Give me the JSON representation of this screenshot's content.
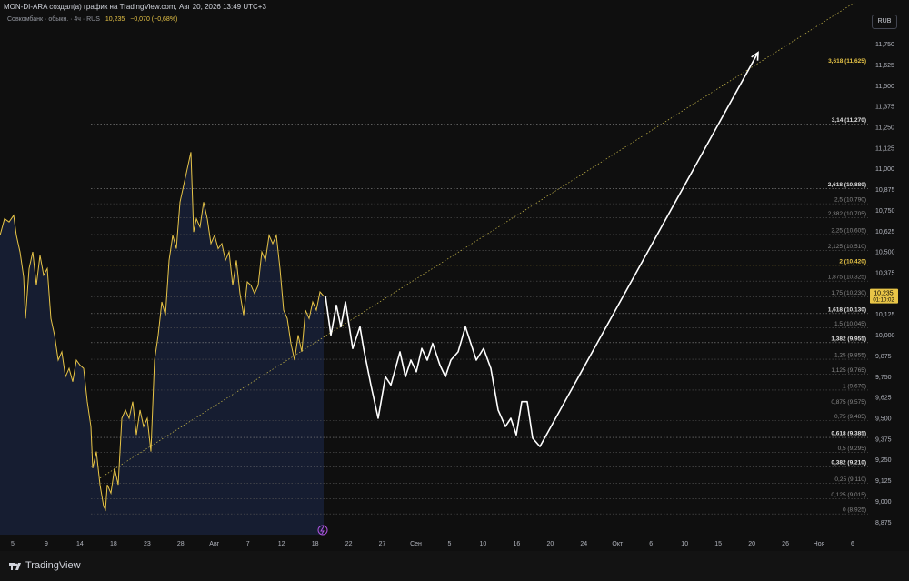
{
  "header": {
    "title": "MON-DI-ARA создал(а) график на TradingView.com, Авг 20, 2026 13:49 UTC+3",
    "symbol": "Совкомбанк · обыкн. · 4ч · RUS",
    "price": "10,235",
    "change": "−0,070 (−0,68%)",
    "currency": "RUB"
  },
  "footer": {
    "brand": "TradingView"
  },
  "colors": {
    "background": "#0f0f0f",
    "price_line": "#e8c547",
    "area_fill": "#1a2340",
    "fib_line": "#6b6b6b",
    "projection": "#ffffff",
    "trendline": "#c8b84a",
    "last_price_bg": "#e8c547"
  },
  "chart_data": {
    "type": "line",
    "ylim": [
      8.8,
      11.95
    ],
    "y_ticks": [
      "11,750",
      "11,625",
      "11,500",
      "11,375",
      "11,250",
      "11,125",
      "11,000",
      "10,875",
      "10,750",
      "10,625",
      "10,500",
      "10,375",
      "10,250",
      "10,125",
      "10,000",
      "9,875",
      "9,750",
      "9,625",
      "9,500",
      "9,375",
      "9,250",
      "9,125",
      "9,000",
      "8,875"
    ],
    "y_tick_values": [
      11.75,
      11.625,
      11.5,
      11.375,
      11.25,
      11.125,
      11.0,
      10.875,
      10.75,
      10.625,
      10.5,
      10.375,
      10.25,
      10.125,
      10.0,
      9.875,
      9.75,
      9.625,
      9.5,
      9.375,
      9.25,
      9.125,
      9.0,
      8.875
    ],
    "x_labels": [
      "5",
      "9",
      "14",
      "18",
      "23",
      "28",
      "Авг",
      "7",
      "12",
      "18",
      "22",
      "27",
      "Сен",
      "5",
      "10",
      "16",
      "20",
      "24",
      "Окт",
      "6",
      "10",
      "15",
      "20",
      "26",
      "Ноя",
      "6"
    ],
    "last_price": {
      "value": 10.235,
      "label": "10,235",
      "timer": "01:10:02"
    },
    "fib_levels": [
      {
        "ratio_label": "3,618 (11,625)",
        "value": 11.625,
        "style": "highlight"
      },
      {
        "ratio_label": "3,14 (11,270)",
        "value": 11.27,
        "style": "bold"
      },
      {
        "ratio_label": "2,618 (10,880)",
        "value": 10.88,
        "style": "bold"
      },
      {
        "ratio_label": "2,5 (10,790)",
        "value": 10.79,
        "style": "dim"
      },
      {
        "ratio_label": "2,382 (10,705)",
        "value": 10.705,
        "style": "dim"
      },
      {
        "ratio_label": "2,25 (10,605)",
        "value": 10.605,
        "style": "dim"
      },
      {
        "ratio_label": "2,125 (10,510)",
        "value": 10.51,
        "style": "dim"
      },
      {
        "ratio_label": "2 (10,420)",
        "value": 10.42,
        "style": "highlight"
      },
      {
        "ratio_label": "1,875 (10,325)",
        "value": 10.325,
        "style": "dim"
      },
      {
        "ratio_label": "1,75 (10,230)",
        "value": 10.23,
        "style": "dim"
      },
      {
        "ratio_label": "1,618 (10,130)",
        "value": 10.13,
        "style": "bold"
      },
      {
        "ratio_label": "1,5 (10,045)",
        "value": 10.045,
        "style": "dim"
      },
      {
        "ratio_label": "1,382 (9,955)",
        "value": 9.955,
        "style": "bold"
      },
      {
        "ratio_label": "1,25 (9,855)",
        "value": 9.855,
        "style": "dim"
      },
      {
        "ratio_label": "1,125 (9,765)",
        "value": 9.765,
        "style": "dim"
      },
      {
        "ratio_label": "1 (9,670)",
        "value": 9.67,
        "style": "dim"
      },
      {
        "ratio_label": "0,875 (9,575)",
        "value": 9.575,
        "style": "dim"
      },
      {
        "ratio_label": "0,75 (9,485)",
        "value": 9.485,
        "style": "dim"
      },
      {
        "ratio_label": "0,618 (9,385)",
        "value": 9.385,
        "style": "bold"
      },
      {
        "ratio_label": "0,5 (9,295)",
        "value": 9.295,
        "style": "dim"
      },
      {
        "ratio_label": "0,382 (9,210)",
        "value": 9.21,
        "style": "bold"
      },
      {
        "ratio_label": "0,25 (9,110)",
        "value": 9.11,
        "style": "dim"
      },
      {
        "ratio_label": "0,125 (9,015)",
        "value": 9.015,
        "style": "dim"
      },
      {
        "ratio_label": "0 (8,925)",
        "value": 8.925,
        "style": "dim"
      }
    ],
    "series": [
      {
        "kind": "price",
        "points": [
          [
            0,
            10.6
          ],
          [
            5,
            10.7
          ],
          [
            10,
            10.68
          ],
          [
            15,
            10.72
          ],
          [
            18,
            10.6
          ],
          [
            22,
            10.5
          ],
          [
            26,
            10.35
          ],
          [
            28,
            10.1
          ],
          [
            32,
            10.4
          ],
          [
            36,
            10.5
          ],
          [
            40,
            10.3
          ],
          [
            44,
            10.48
          ],
          [
            48,
            10.36
          ],
          [
            52,
            10.4
          ],
          [
            56,
            10.1
          ],
          [
            60,
            10.0
          ],
          [
            64,
            9.85
          ],
          [
            68,
            9.9
          ],
          [
            72,
            9.75
          ],
          [
            76,
            9.8
          ],
          [
            80,
            9.72
          ],
          [
            84,
            9.85
          ],
          [
            88,
            9.82
          ],
          [
            92,
            9.8
          ],
          [
            96,
            9.6
          ],
          [
            100,
            9.45
          ],
          [
            102,
            9.2
          ],
          [
            106,
            9.3
          ],
          [
            110,
            9.1
          ],
          [
            114,
            8.97
          ],
          [
            116,
            8.95
          ],
          [
            118,
            9.1
          ],
          [
            122,
            9.05
          ],
          [
            126,
            9.2
          ],
          [
            130,
            9.1
          ],
          [
            134,
            9.5
          ],
          [
            138,
            9.55
          ],
          [
            142,
            9.5
          ],
          [
            146,
            9.6
          ],
          [
            150,
            9.4
          ],
          [
            154,
            9.55
          ],
          [
            158,
            9.45
          ],
          [
            162,
            9.5
          ],
          [
            166,
            9.3
          ],
          [
            170,
            9.85
          ],
          [
            174,
            10.0
          ],
          [
            178,
            10.2
          ],
          [
            182,
            10.12
          ],
          [
            186,
            10.45
          ],
          [
            190,
            10.6
          ],
          [
            194,
            10.52
          ],
          [
            198,
            10.8
          ],
          [
            202,
            10.9
          ],
          [
            206,
            11.0
          ],
          [
            210,
            11.1
          ],
          [
            213,
            10.62
          ],
          [
            216,
            10.7
          ],
          [
            220,
            10.65
          ],
          [
            224,
            10.8
          ],
          [
            228,
            10.7
          ],
          [
            232,
            10.55
          ],
          [
            236,
            10.6
          ],
          [
            240,
            10.52
          ],
          [
            244,
            10.55
          ],
          [
            248,
            10.45
          ],
          [
            252,
            10.5
          ],
          [
            256,
            10.3
          ],
          [
            260,
            10.45
          ],
          [
            264,
            10.25
          ],
          [
            268,
            10.12
          ],
          [
            272,
            10.32
          ],
          [
            276,
            10.3
          ],
          [
            280,
            10.25
          ],
          [
            284,
            10.3
          ],
          [
            288,
            10.5
          ],
          [
            292,
            10.45
          ],
          [
            296,
            10.6
          ],
          [
            300,
            10.55
          ],
          [
            304,
            10.6
          ],
          [
            308,
            10.4
          ],
          [
            312,
            10.15
          ],
          [
            316,
            10.1
          ],
          [
            320,
            9.95
          ],
          [
            324,
            9.85
          ],
          [
            328,
            10.0
          ],
          [
            332,
            9.9
          ],
          [
            336,
            10.15
          ],
          [
            340,
            10.1
          ],
          [
            344,
            10.2
          ],
          [
            348,
            10.15
          ],
          [
            352,
            10.26
          ],
          [
            356,
            10.235
          ]
        ]
      },
      {
        "kind": "projection",
        "points": [
          [
            358,
            10.235
          ],
          [
            364,
            10.0
          ],
          [
            370,
            10.18
          ],
          [
            375,
            10.05
          ],
          [
            380,
            10.2
          ],
          [
            388,
            9.92
          ],
          [
            396,
            10.05
          ],
          [
            400,
            9.92
          ],
          [
            408,
            9.7
          ],
          [
            416,
            9.5
          ],
          [
            424,
            9.75
          ],
          [
            430,
            9.7
          ],
          [
            440,
            9.9
          ],
          [
            446,
            9.75
          ],
          [
            452,
            9.85
          ],
          [
            458,
            9.78
          ],
          [
            464,
            9.92
          ],
          [
            470,
            9.85
          ],
          [
            476,
            9.95
          ],
          [
            484,
            9.82
          ],
          [
            490,
            9.75
          ],
          [
            496,
            9.85
          ],
          [
            504,
            9.9
          ],
          [
            512,
            10.05
          ],
          [
            518,
            9.95
          ],
          [
            524,
            9.85
          ],
          [
            532,
            9.92
          ],
          [
            540,
            9.8
          ],
          [
            548,
            9.55
          ],
          [
            556,
            9.45
          ],
          [
            562,
            9.5
          ],
          [
            568,
            9.4
          ],
          [
            574,
            9.6
          ],
          [
            580,
            9.6
          ],
          [
            586,
            9.38
          ],
          [
            594,
            9.33
          ],
          [
            834,
            11.7
          ]
        ]
      },
      {
        "kind": "trendline",
        "points": [
          [
            110,
            9.14
          ],
          [
            940,
            12.0
          ]
        ]
      }
    ]
  }
}
